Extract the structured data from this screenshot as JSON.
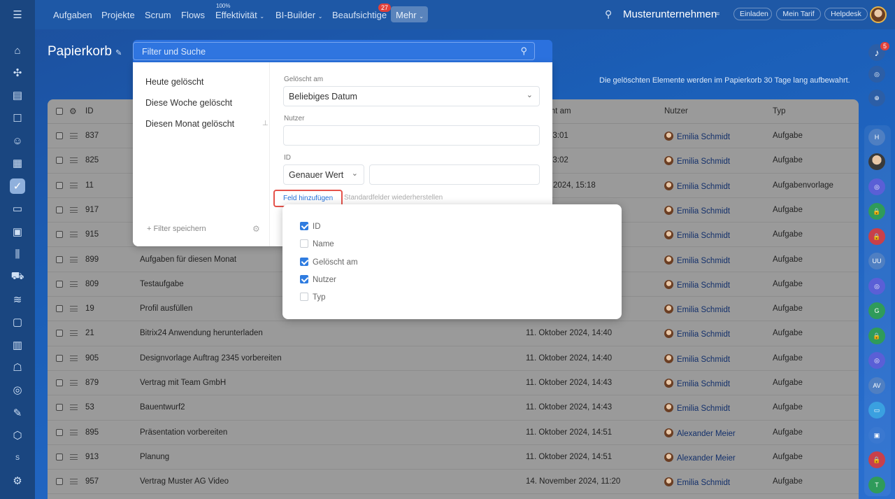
{
  "nav": {
    "items": [
      "Aufgaben",
      "Projekte",
      "Scrum",
      "Flows",
      "Effektivität",
      "BI-Builder",
      "Beaufsichtige",
      "Mehr"
    ],
    "effektivitaet_percent": "100%",
    "beaufsichtige_badge": "27"
  },
  "header": {
    "company": "Musterunternehmen",
    "invite": "Einladen",
    "tariff": "Mein Tarif",
    "helpdesk": "Helpdesk",
    "notif_badge": "5"
  },
  "page": {
    "title": "Papierkorb",
    "notice": "Die gelöschten Elemente werden im Papierkorb 30 Tage lang aufbewahrt."
  },
  "search": {
    "placeholder": "Filter und Suche"
  },
  "filter": {
    "presets": [
      "Heute gelöscht",
      "Diese Woche gelöscht",
      "Diesen Monat gelöscht"
    ],
    "save_filter": "Filter speichern",
    "deleted_label": "Gelöscht am",
    "deleted_value": "Beliebiges Datum",
    "user_label": "Nutzer",
    "user_value": "",
    "id_label": "ID",
    "id_mode": "Genauer Wert",
    "id_value": "",
    "add_field": "Feld hinzufügen",
    "restore_fields": "Standardfelder wiederherstellen"
  },
  "field_popup": {
    "options": [
      {
        "label": "ID",
        "checked": true
      },
      {
        "label": "Name",
        "checked": false
      },
      {
        "label": "Gelöscht am",
        "checked": true
      },
      {
        "label": "Nutzer",
        "checked": true
      },
      {
        "label": "Typ",
        "checked": false
      }
    ]
  },
  "table": {
    "headers": {
      "id": "ID",
      "deleted": "Gelöscht am",
      "user": "Nutzer",
      "type": "Typ"
    },
    "rows": [
      {
        "id": "837",
        "name": "",
        "deleted": "2024, 13:01",
        "user": "Emilia Schmidt",
        "type": "Aufgabe"
      },
      {
        "id": "825",
        "name": "",
        "deleted": "2024, 13:02",
        "user": "Emilia Schmidt",
        "type": "Aufgabe"
      },
      {
        "id": "11",
        "name": "",
        "deleted": "tember 2024, 15:18",
        "user": "Emilia Schmidt",
        "type": "Aufgabenvorlage"
      },
      {
        "id": "917",
        "name": "",
        "deleted": "",
        "user": "Emilia Schmidt",
        "type": "Aufgabe"
      },
      {
        "id": "915",
        "name": "",
        "deleted": "",
        "user": "Emilia Schmidt",
        "type": "Aufgabe"
      },
      {
        "id": "899",
        "name": "Aufgaben für diesen Monat",
        "deleted": "",
        "user": "Emilia Schmidt",
        "type": "Aufgabe"
      },
      {
        "id": "809",
        "name": "Testaufgabe",
        "deleted": "",
        "user": "Emilia Schmidt",
        "type": "Aufgabe"
      },
      {
        "id": "19",
        "name": "Profil ausfüllen",
        "deleted": "",
        "user": "Emilia Schmidt",
        "type": "Aufgabe"
      },
      {
        "id": "21",
        "name": "Bitrix24 Anwendung herunterladen",
        "deleted": "11. Oktober 2024, 14:40",
        "user": "Emilia Schmidt",
        "type": "Aufgabe"
      },
      {
        "id": "905",
        "name": "Designvorlage Auftrag 2345 vorbereiten",
        "deleted": "11. Oktober 2024, 14:40",
        "user": "Emilia Schmidt",
        "type": "Aufgabe"
      },
      {
        "id": "879",
        "name": "Vertrag mit Team GmbH",
        "deleted": "11. Oktober 2024, 14:43",
        "user": "Emilia Schmidt",
        "type": "Aufgabe"
      },
      {
        "id": "53",
        "name": "Bauentwurf2",
        "deleted": "11. Oktober 2024, 14:43",
        "user": "Emilia Schmidt",
        "type": "Aufgabe"
      },
      {
        "id": "895",
        "name": "Präsentation vorbereiten",
        "deleted": "11. Oktober 2024, 14:51",
        "user": "Alexander Meier",
        "type": "Aufgabe"
      },
      {
        "id": "913",
        "name": "Planung",
        "deleted": "11. Oktober 2024, 14:51",
        "user": "Alexander Meier",
        "type": "Aufgabe"
      },
      {
        "id": "957",
        "name": "Vertrag Muster AG Video",
        "deleted": "14. November 2024, 11:20",
        "user": "Emilia Schmidt",
        "type": "Aufgabe"
      }
    ]
  },
  "rightbar": {
    "labels": [
      "H",
      "",
      "",
      "",
      "",
      "",
      "UU",
      "",
      "G",
      "",
      "",
      "AV",
      "",
      "",
      "",
      "T"
    ]
  }
}
